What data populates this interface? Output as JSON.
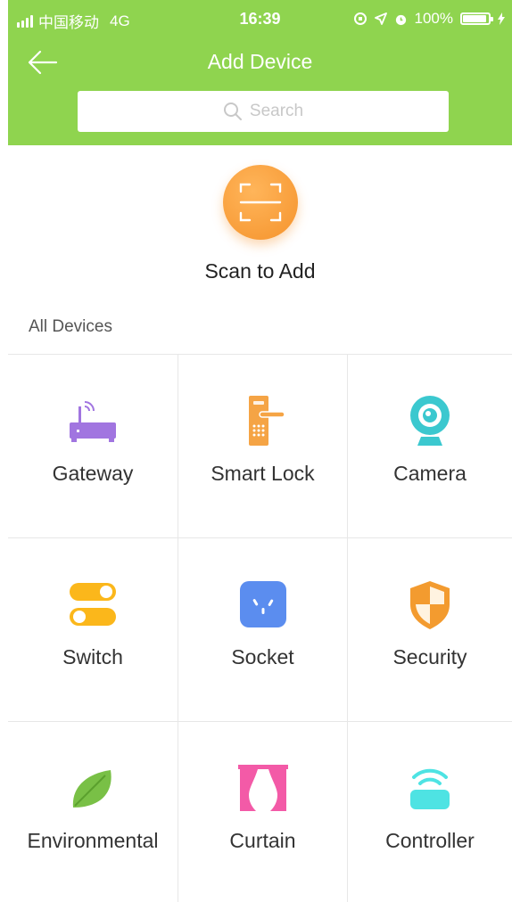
{
  "status_bar": {
    "carrier": "中国移动",
    "network": "4G",
    "time": "16:39",
    "battery": "100%"
  },
  "header": {
    "title": "Add Device",
    "search_placeholder": "Search",
    "back_icon": "arrow-left-icon"
  },
  "scan": {
    "label": "Scan to Add",
    "icon": "scan-icon"
  },
  "section_label": "All Devices",
  "devices": [
    {
      "label": "Gateway",
      "icon": "router-icon",
      "color": "#a175e0"
    },
    {
      "label": "Smart Lock",
      "icon": "door-lock-icon",
      "color": "#f5a445"
    },
    {
      "label": "Camera",
      "icon": "camera-icon",
      "color": "#3bc8cf"
    },
    {
      "label": "Switch",
      "icon": "toggle-switch-icon",
      "color": "#fbb71b"
    },
    {
      "label": "Socket",
      "icon": "socket-icon",
      "color": "#5b8def"
    },
    {
      "label": "Security",
      "icon": "shield-icon",
      "color": "#f39b2f"
    },
    {
      "label": "Environmental",
      "icon": "leaf-icon",
      "color": "#79c046"
    },
    {
      "label": "Curtain",
      "icon": "curtain-icon",
      "color": "#f35aa7"
    },
    {
      "label": "Controller",
      "icon": "remote-controller-icon",
      "color": "#4ee3e3"
    }
  ],
  "colors": {
    "header_green": "#8fd44f",
    "scan_orange": "#f5932c"
  }
}
